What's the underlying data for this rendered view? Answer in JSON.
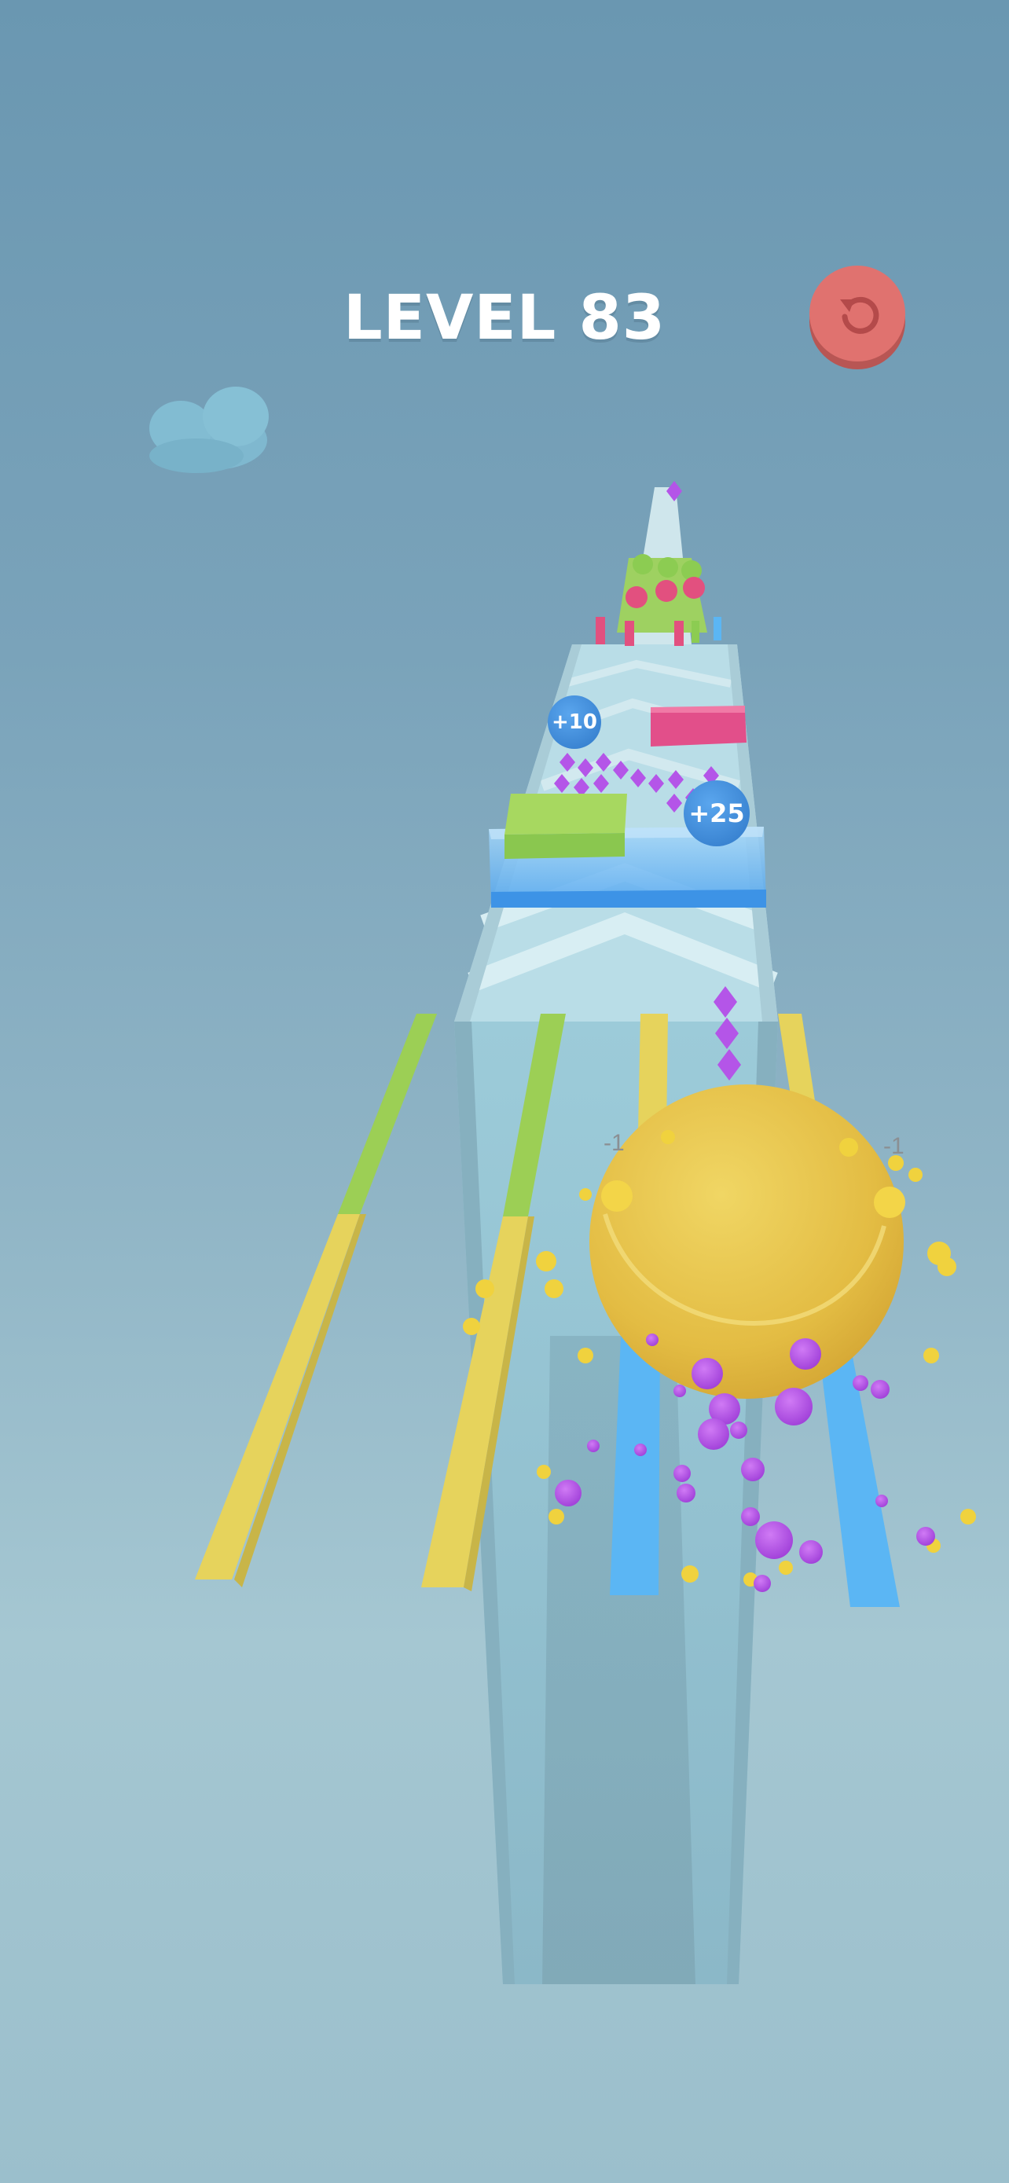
{
  "hud": {
    "level_label": "LEVEL 83"
  },
  "restart_button": {
    "icon": "restart-icon",
    "color": "#e0726f"
  },
  "track_bonuses": [
    {
      "label": "+10"
    },
    {
      "label": "+25"
    }
  ],
  "ball_side_labels": [
    {
      "label": "-1"
    },
    {
      "label": "-1"
    }
  ],
  "colors": {
    "ball": "#e8c54a",
    "gem": "#b455e8",
    "lane_green": "#9ccf55",
    "lane_yellow": "#e6d35c",
    "lane_blue": "#5bb6f4",
    "block_pink": "#e24f8a",
    "block_green": "#8fcc52",
    "water": "#58adf0"
  }
}
